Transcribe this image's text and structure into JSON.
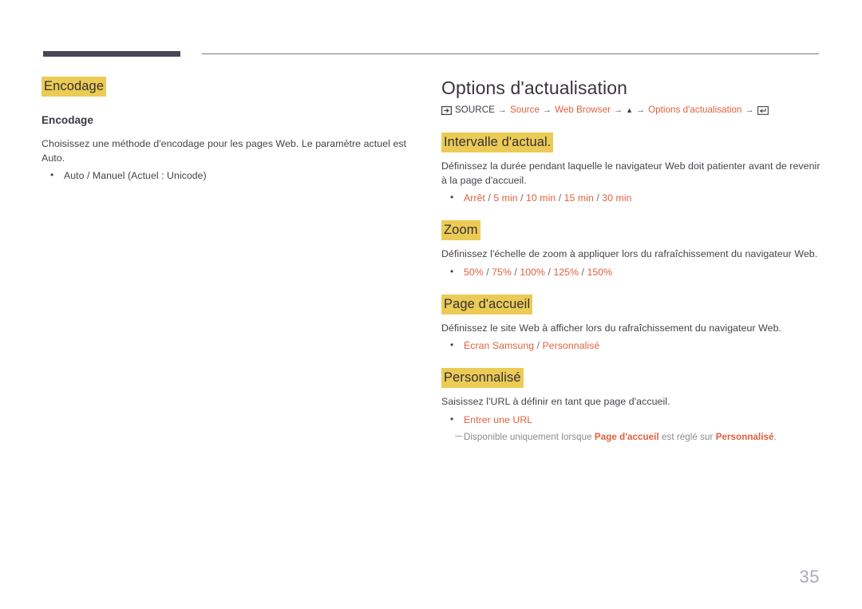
{
  "page": {
    "number": "35",
    "background_color": "#ffffff",
    "rule_color_thick": "#474758",
    "rule_color_thin": "#7c7c82",
    "highlight_color": "#eccb55",
    "accent_color": "#e0603c",
    "title_color": "#3c3440"
  },
  "left_column": {
    "highlight_heading": "Encodage",
    "subheading": "Encodage",
    "description": "Choisissez une méthode d'encodage pour les pages Web. Le paramètre actuel est Auto.",
    "options": [
      {
        "parts": [
          {
            "text": "Auto / Manuel (Actuel : Unicode)",
            "style": "plain"
          }
        ]
      }
    ]
  },
  "right_column": {
    "title": "Options d'actualisation",
    "breadcrumb": {
      "lead_icon": "source-input-icon",
      "trail_icon": "enter-key-icon",
      "arrow": "→",
      "up_glyph": "▲",
      "items": [
        {
          "text": "SOURCE",
          "style": "plain"
        },
        {
          "text": "Source",
          "style": "link"
        },
        {
          "text": "Web Browser",
          "style": "link"
        },
        {
          "text": "▲",
          "style": "up"
        },
        {
          "text": "Options d'actualisation",
          "style": "link"
        }
      ]
    },
    "sections": [
      {
        "heading": "Intervalle d'actual.",
        "description": "Définissez la durée pendant laquelle le navigateur Web doit patienter avant de revenir à la page d'accueil.",
        "options_line": {
          "values": [
            "Arrêt",
            "5 min",
            "10 min",
            "15 min",
            "30 min"
          ],
          "separator": "/"
        }
      },
      {
        "heading": "Zoom",
        "description": "Définissez l'échelle de zoom à appliquer lors du rafraîchissement du navigateur Web.",
        "options_line": {
          "values": [
            "50%",
            "75%",
            "100%",
            "125%",
            "150%"
          ],
          "separator": "/"
        }
      },
      {
        "heading": "Page d'accueil",
        "description": "Définissez le site Web à afficher lors du rafraîchissement du navigateur Web.",
        "options_line": {
          "values": [
            "Écran Samsung",
            "Personnalisé"
          ],
          "separator": "/"
        }
      },
      {
        "heading": "Personnalisé",
        "description": "Saisissez l'URL à définir en tant que page d'accueil.",
        "options_line": {
          "values": [
            "Entrer une URL"
          ],
          "separator": "/"
        },
        "note": {
          "prefix": "Disponible uniquement lorsque ",
          "term1": "Page d'accueil",
          "middle": " est réglé sur ",
          "term2": "Personnalisé",
          "suffix": "."
        }
      }
    ]
  }
}
